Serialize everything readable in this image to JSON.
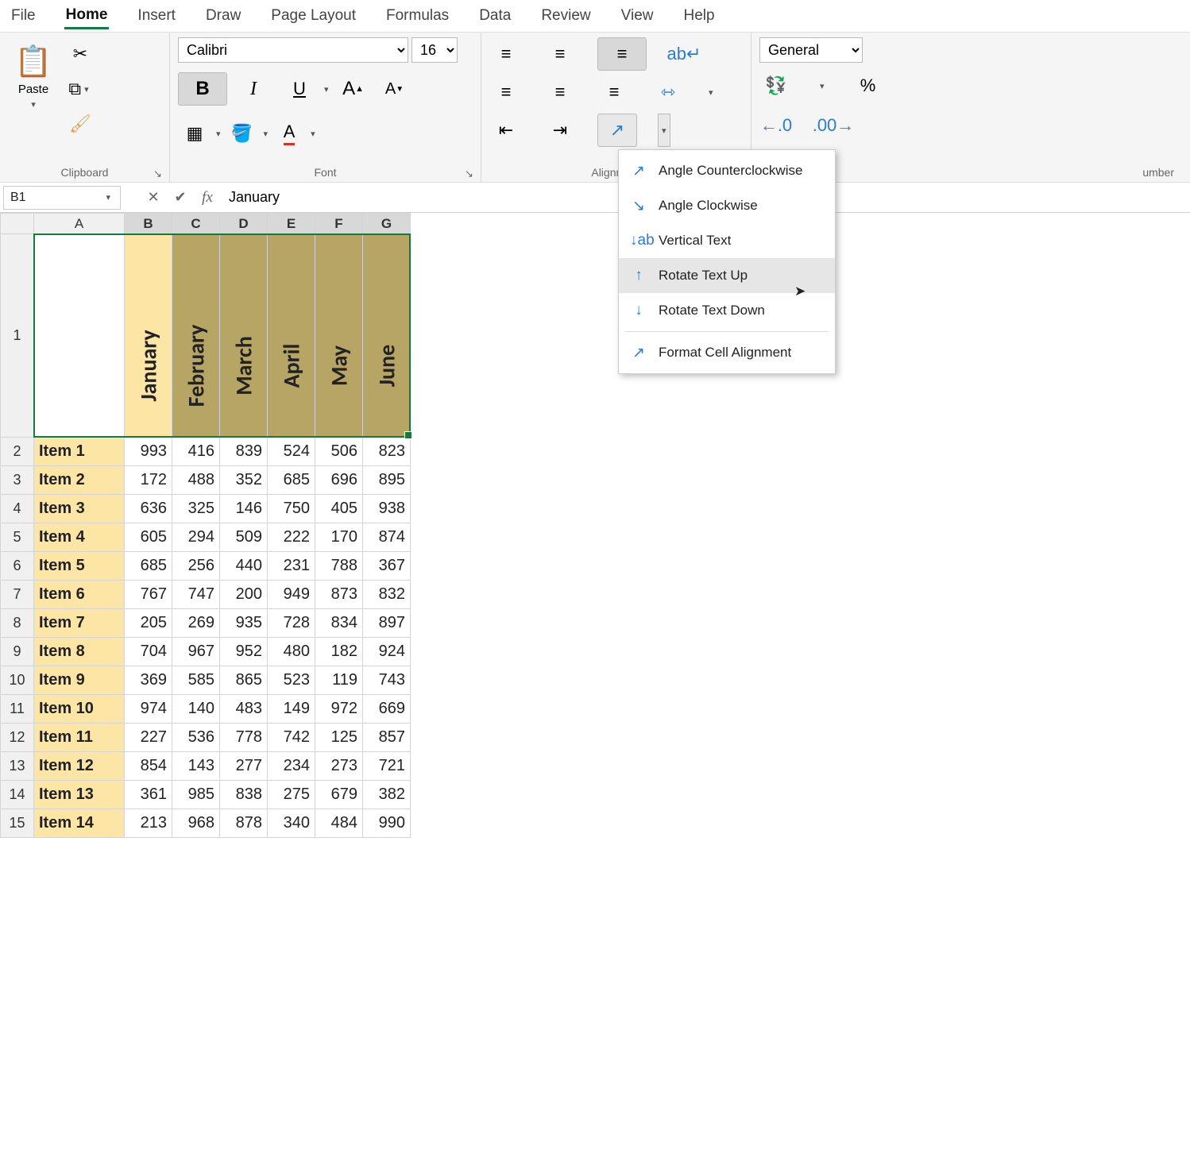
{
  "tabs": [
    "File",
    "Home",
    "Insert",
    "Draw",
    "Page Layout",
    "Formulas",
    "Data",
    "Review",
    "View",
    "Help"
  ],
  "active_tab": "Home",
  "clipboard": {
    "paste": "Paste",
    "label": "Clipboard"
  },
  "font": {
    "label": "Font",
    "name": "Calibri",
    "size": "16"
  },
  "alignment": {
    "label": "Alignment"
  },
  "number": {
    "label": "Number",
    "format": "General"
  },
  "orientation_menu": [
    "Angle Counterclockwise",
    "Angle Clockwise",
    "Vertical Text",
    "Rotate Text Up",
    "Rotate Text Down",
    "Format Cell Alignment"
  ],
  "orientation_highlight_index": 3,
  "namebox": "B1",
  "formula": "January",
  "columns": [
    "A",
    "B",
    "C",
    "D",
    "E",
    "F",
    "G"
  ],
  "selected_cols": [
    "B",
    "C",
    "D",
    "E",
    "F",
    "G"
  ],
  "months": [
    "January",
    "February",
    "March",
    "April",
    "May",
    "June"
  ],
  "rows": [
    {
      "n": 1
    },
    {
      "n": 2,
      "label": "Item 1",
      "v": [
        993,
        416,
        839,
        524,
        506,
        823
      ]
    },
    {
      "n": 3,
      "label": "Item 2",
      "v": [
        172,
        488,
        352,
        685,
        696,
        895
      ]
    },
    {
      "n": 4,
      "label": "Item 3",
      "v": [
        636,
        325,
        146,
        750,
        405,
        938
      ]
    },
    {
      "n": 5,
      "label": "Item 4",
      "v": [
        605,
        294,
        509,
        222,
        170,
        874
      ]
    },
    {
      "n": 6,
      "label": "Item 5",
      "v": [
        685,
        256,
        440,
        231,
        788,
        367
      ]
    },
    {
      "n": 7,
      "label": "Item 6",
      "v": [
        767,
        747,
        200,
        949,
        873,
        832
      ]
    },
    {
      "n": 8,
      "label": "Item 7",
      "v": [
        205,
        269,
        935,
        728,
        834,
        897
      ]
    },
    {
      "n": 9,
      "label": "Item 8",
      "v": [
        704,
        967,
        952,
        480,
        182,
        924
      ]
    },
    {
      "n": 10,
      "label": "Item 9",
      "v": [
        369,
        585,
        865,
        523,
        119,
        743
      ]
    },
    {
      "n": 11,
      "label": "Item 10",
      "v": [
        974,
        140,
        483,
        149,
        972,
        669
      ]
    },
    {
      "n": 12,
      "label": "Item 11",
      "v": [
        227,
        536,
        778,
        742,
        125,
        857
      ]
    },
    {
      "n": 13,
      "label": "Item 12",
      "v": [
        854,
        143,
        277,
        234,
        273,
        721
      ]
    },
    {
      "n": 14,
      "label": "Item 13",
      "v": [
        361,
        985,
        838,
        275,
        679,
        382
      ]
    },
    {
      "n": 15,
      "label": "Item 14",
      "v": [
        213,
        968,
        878,
        340,
        484,
        990
      ]
    }
  ],
  "colors": {
    "header_active_bg": "#fce5a5",
    "header_sel_bg": "#b7a565",
    "selection_border": "#107c41"
  }
}
